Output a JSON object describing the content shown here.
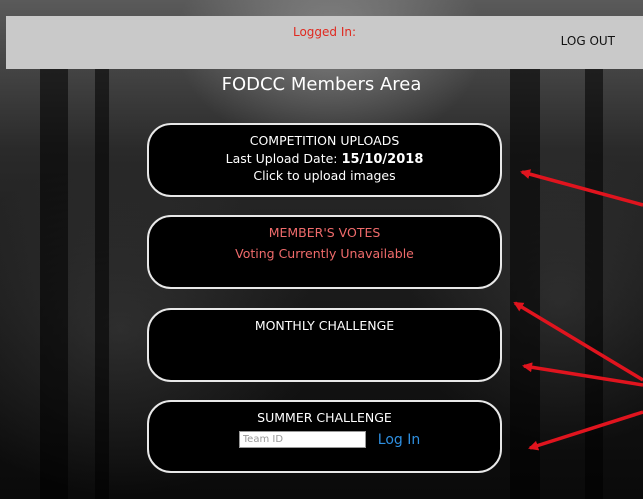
{
  "header": {
    "logged_in_label": "Logged In:",
    "logout_label": "LOG OUT"
  },
  "page_title": "FODCC Members Area",
  "cards": {
    "competition": {
      "title": "COMPETITION UPLOADS",
      "last_upload_label": "Last Upload Date:",
      "last_upload_date": "15/10/2018",
      "upload_prompt": "Click to upload images"
    },
    "votes": {
      "title": "MEMBER'S VOTES",
      "status": "Voting Currently Unavailable"
    },
    "monthly": {
      "title": "MONTHLY CHALLENGE"
    },
    "summer": {
      "title": "SUMMER CHALLENGE",
      "team_id_placeholder": "Team ID",
      "login_label": "Log In"
    }
  },
  "colors": {
    "accent_red": "#e0291f",
    "votes_pink": "#ef6b6b",
    "link_blue": "#2e8fe0",
    "annotation_arrow": "#e0141e"
  }
}
